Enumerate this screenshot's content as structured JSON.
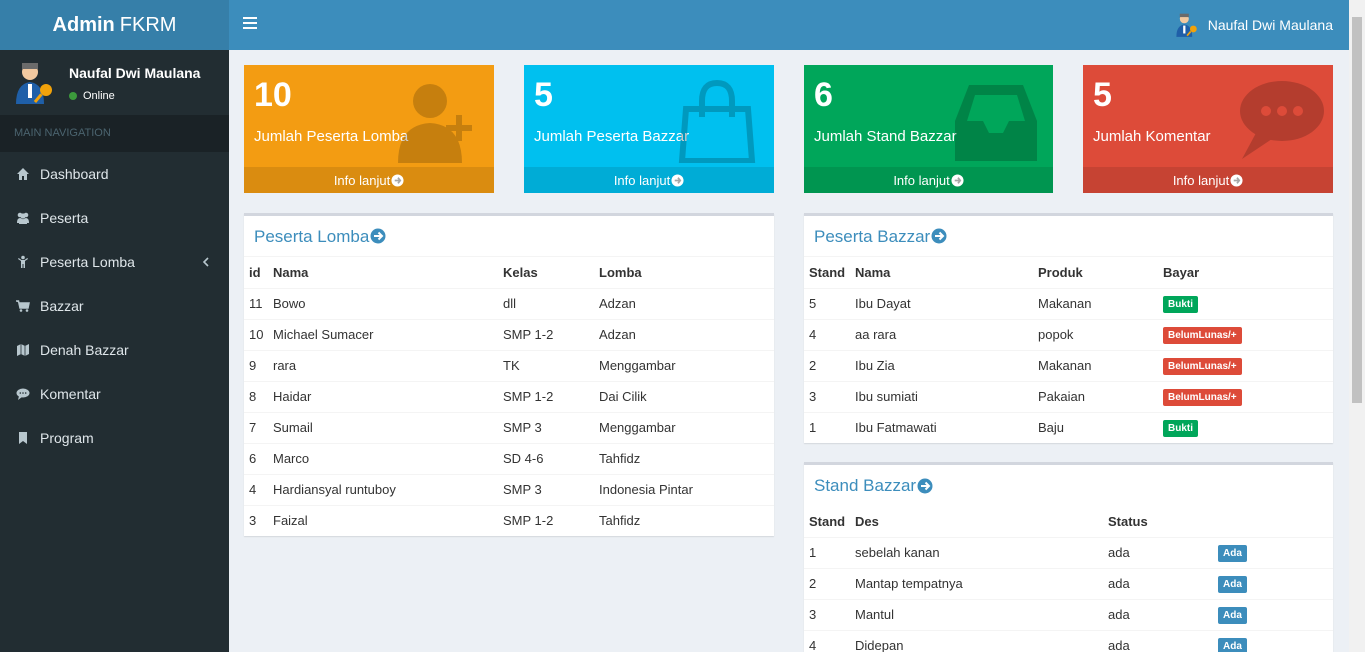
{
  "brand": {
    "bold": "Admin",
    "rest": "FKRM"
  },
  "topbar": {
    "user_name": "Naufal Dwi Maulana"
  },
  "sidebar": {
    "user": {
      "name": "Naufal Dwi Maulana",
      "status": "Online"
    },
    "nav_header": "MAIN NAVIGATION",
    "items": [
      {
        "label": "Dashboard",
        "icon": "home-icon"
      },
      {
        "label": "Peserta",
        "icon": "users-icon"
      },
      {
        "label": "Peserta Lomba",
        "icon": "child-icon"
      },
      {
        "label": "Bazzar",
        "icon": "cart-icon"
      },
      {
        "label": "Denah Bazzar",
        "icon": "map-icon"
      },
      {
        "label": "Komentar",
        "icon": "comment-icon"
      },
      {
        "label": "Program",
        "icon": "bookmark-icon"
      }
    ]
  },
  "boxes": [
    {
      "number": "10",
      "label": "Jumlah Peserta Lomba",
      "footer": "Info lanjut",
      "color": "#f39c12",
      "icon": "user-plus-icon"
    },
    {
      "number": "5",
      "label": "Jumlah Peserta Bazzar",
      "footer": "Info lanjut",
      "color": "#00c0ef",
      "icon": "shopping-bag-icon"
    },
    {
      "number": "6",
      "label": "Jumlah Stand Bazzar",
      "footer": "Info lanjut",
      "color": "#00a65a",
      "icon": "inbox-icon"
    },
    {
      "number": "5",
      "label": "Jumlah Komentar",
      "footer": "Info lanjut",
      "color": "#dd4b39",
      "icon": "comments-icon"
    }
  ],
  "peserta_lomba": {
    "title": "Peserta Lomba",
    "headers": [
      "id",
      "Nama",
      "Kelas",
      "Lomba"
    ],
    "rows": [
      [
        "11",
        "Bowo",
        "dll",
        "Adzan"
      ],
      [
        "10",
        "Michael Sumacer",
        "SMP 1-2",
        "Adzan"
      ],
      [
        "9",
        "rara",
        "TK",
        "Menggambar"
      ],
      [
        "8",
        "Haidar",
        "SMP 1-2",
        "Dai Cilik"
      ],
      [
        "7",
        "Sumail",
        "SMP 3",
        "Menggambar"
      ],
      [
        "6",
        "Marco",
        "SD 4-6",
        "Tahfidz"
      ],
      [
        "4",
        "Hardiansyal runtuboy",
        "SMP 3",
        "Indonesia Pintar"
      ],
      [
        "3",
        "Faizal",
        "SMP 1-2",
        "Tahfidz"
      ]
    ]
  },
  "peserta_bazzar": {
    "title": "Peserta Bazzar",
    "headers": [
      "Stand",
      "Nama",
      "Produk",
      "Bayar"
    ],
    "rows": [
      {
        "stand": "5",
        "nama": "Ibu Dayat",
        "produk": "Makanan",
        "bayar": "Bukti",
        "color": "#00a65a"
      },
      {
        "stand": "4",
        "nama": "aa rara",
        "produk": "popok",
        "bayar": "BelumLunas/+",
        "color": "#dd4b39"
      },
      {
        "stand": "2",
        "nama": "Ibu Zia",
        "produk": "Makanan",
        "bayar": "BelumLunas/+",
        "color": "#dd4b39"
      },
      {
        "stand": "3",
        "nama": "Ibu sumiati",
        "produk": "Pakaian",
        "bayar": "BelumLunas/+",
        "color": "#dd4b39"
      },
      {
        "stand": "1",
        "nama": "Ibu Fatmawati",
        "produk": "Baju",
        "bayar": "Bukti",
        "color": "#00a65a"
      }
    ]
  },
  "stand_bazzar": {
    "title": "Stand Bazzar",
    "headers": [
      "Stand",
      "Des",
      "Status"
    ],
    "rows": [
      {
        "stand": "1",
        "des": "sebelah kanan",
        "status": "ada",
        "badge": "Ada"
      },
      {
        "stand": "2",
        "des": "Mantap tempatnya",
        "status": "ada",
        "badge": "Ada"
      },
      {
        "stand": "3",
        "des": "Mantul",
        "status": "ada",
        "badge": "Ada"
      },
      {
        "stand": "4",
        "des": "Didepan",
        "status": "ada",
        "badge": "Ada"
      }
    ]
  }
}
